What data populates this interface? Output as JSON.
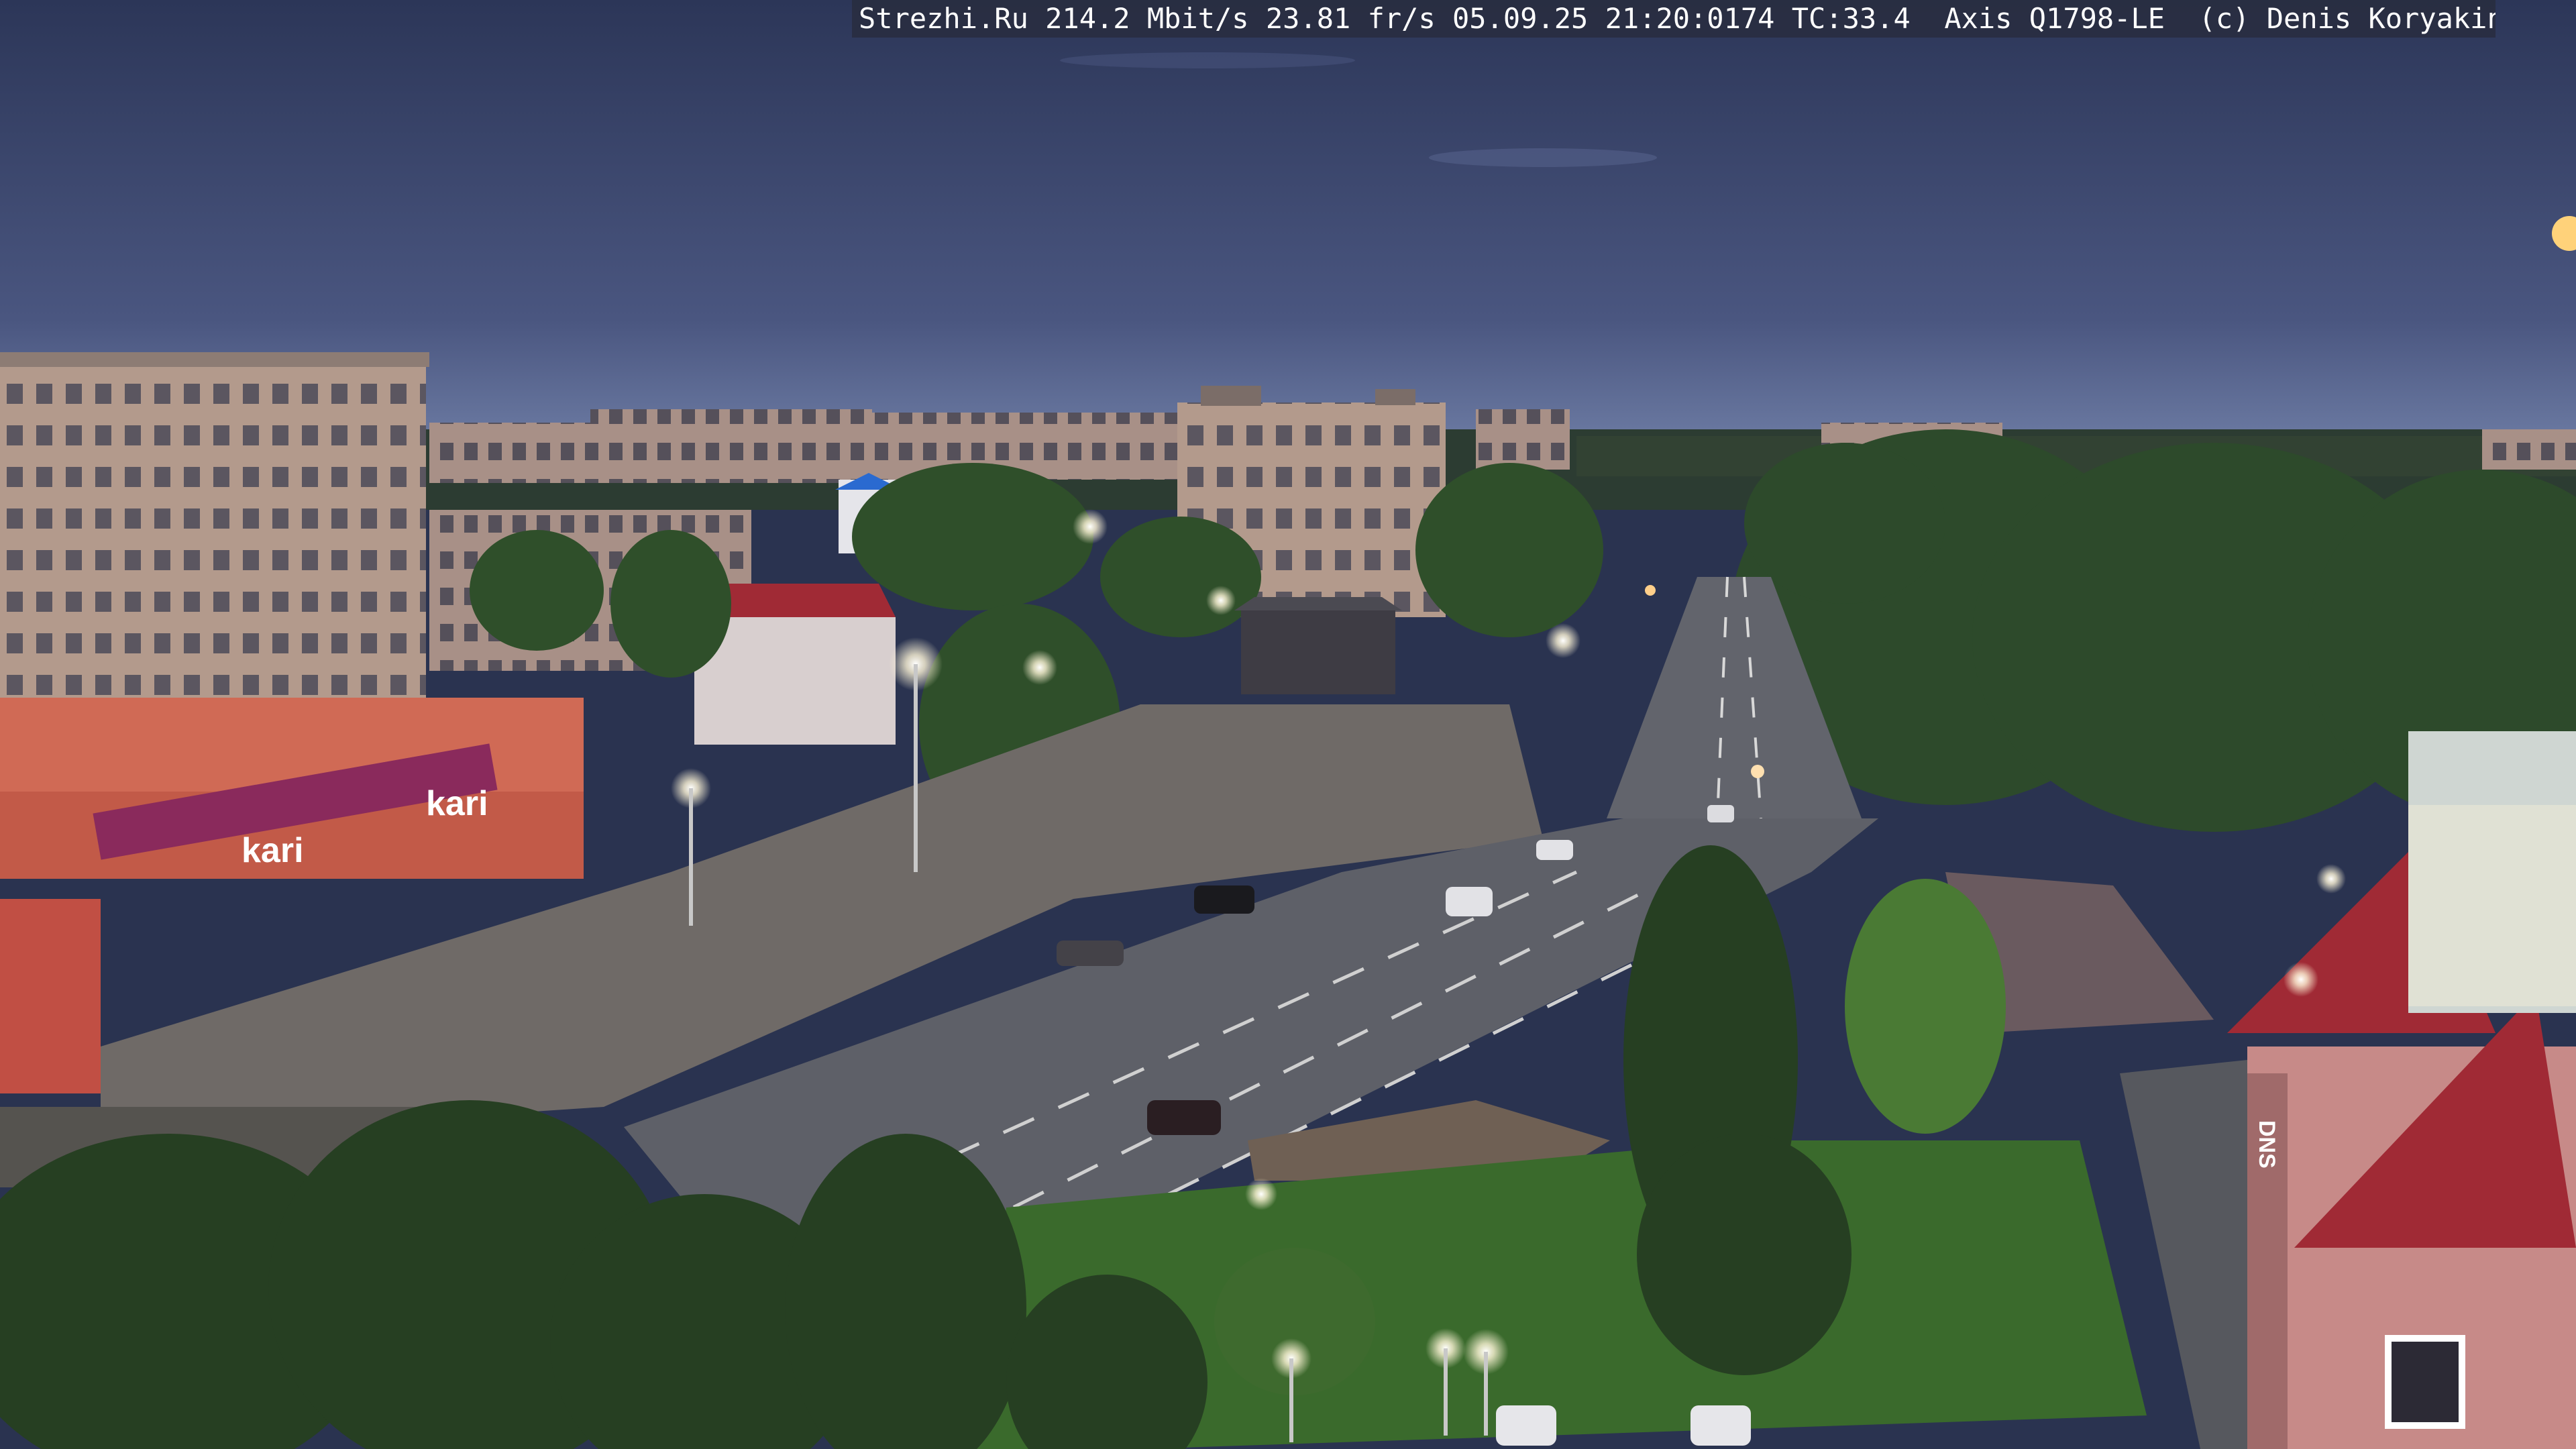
{
  "overlay": {
    "caption": "Strezhi.Ru 214.2 Mbit/s 23.81 fr/s 05.09.25 21:20:0174 TC:33.4  Axis Q1798-LE  (c) Denis Koryakin"
  },
  "signage": {
    "store_sign_1": "kari",
    "store_sign_2": "kari",
    "building_right_sign": "DNS"
  },
  "colors": {
    "sky_top": "#2c3658",
    "sky_horizon": "#6f7ea6",
    "building_brick": "#b39a8c",
    "store_facade": "#d06a55",
    "kari_banner": "#8a2a5c",
    "road": "#5e6068",
    "foliage": "#2f4f2a",
    "roof_red": "#a02a35",
    "moon": "#ffd27a"
  },
  "icons": [
    "moon-icon",
    "streetlight-icon",
    "car-icon"
  ]
}
